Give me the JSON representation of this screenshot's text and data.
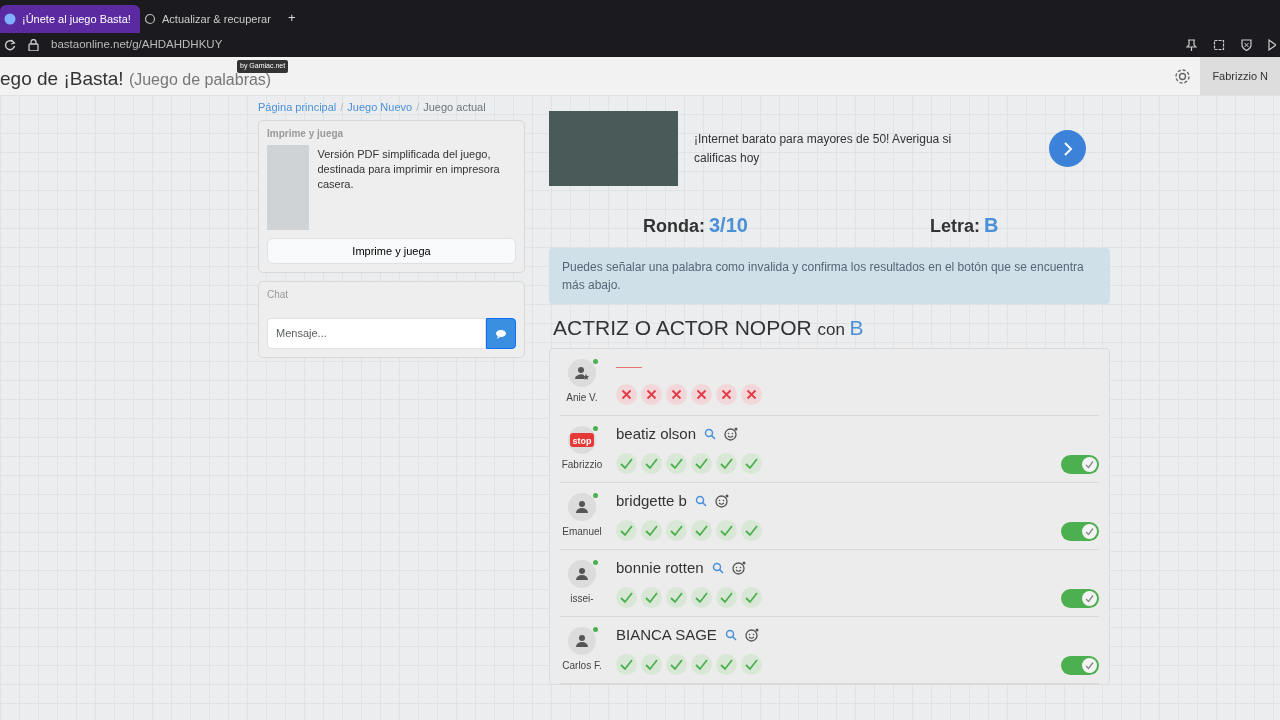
{
  "browser": {
    "tabs": [
      {
        "label": "¡Únete al juego Basta!",
        "selected": true
      },
      {
        "label": "Actualizar & recuperar",
        "selected": false
      }
    ],
    "new_tab": "+",
    "url": "bastaonline.net/g/AHDAHDHKUY"
  },
  "header": {
    "title": "ego de ¡Basta!",
    "subtitle": "(Juego de palabras)",
    "badge": "by Gamiac.net",
    "user": "Fabrizzio N"
  },
  "breadcrumb": [
    {
      "label": "Página principal",
      "kind": "link"
    },
    {
      "separator": "/",
      "label": "Juego Nuevo",
      "kind": "link"
    },
    {
      "separator": "/",
      "label": "Juego actual",
      "kind": "current"
    }
  ],
  "print_card": {
    "title": "Imprime y juega",
    "text": "Versión PDF simplificada del juego, destinada para imprimir en impresora casera.",
    "button": "Imprime y juega"
  },
  "chat": {
    "title": "Chat",
    "placeholder": "Mensaje..."
  },
  "ad": {
    "text": "¡Internet barato para mayores de 50! Averigua si calificas hoy"
  },
  "round": {
    "label": "Ronda:",
    "value": "3/10"
  },
  "letter": {
    "label": "Letra:",
    "value": "B"
  },
  "info": "Puedes señalar una palabra como invalida y confirma los resultados en el botón que se encuentra más abajo.",
  "category": {
    "name": "ACTRIZ O ACTOR NOPOR",
    "connector": "con",
    "letter": "B"
  },
  "answers": [
    {
      "player": "Anie V.",
      "kind": "star-user",
      "online": true,
      "votes": [
        {
          "valid": false
        },
        {
          "valid": false
        },
        {
          "valid": false
        },
        {
          "valid": false
        },
        {
          "valid": false
        },
        {
          "valid": false
        }
      ]
    },
    {
      "player": "Fabrizzio",
      "kind": "stop",
      "online": true,
      "answer": "beatiz olson",
      "votes": [
        {
          "valid": true
        },
        {
          "valid": true
        },
        {
          "valid": true
        },
        {
          "valid": true
        },
        {
          "valid": true
        },
        {
          "valid": true
        }
      ],
      "accepted": true
    },
    {
      "player": "Emanuel",
      "kind": "user",
      "online": true,
      "answer": "bridgette b",
      "votes": [
        {
          "valid": true
        },
        {
          "valid": true
        },
        {
          "valid": true
        },
        {
          "valid": true
        },
        {
          "valid": true
        },
        {
          "valid": true
        }
      ],
      "accepted": true
    },
    {
      "player": "issei-",
      "kind": "user",
      "online": true,
      "answer": "bonnie rotten",
      "votes": [
        {
          "valid": true
        },
        {
          "valid": true
        },
        {
          "valid": true
        },
        {
          "valid": true
        },
        {
          "valid": true
        },
        {
          "valid": true
        }
      ],
      "accepted": true
    },
    {
      "player": "Carlos F.",
      "kind": "user",
      "online": true,
      "answer": "BIANCA SAGE",
      "votes": [
        {
          "valid": true
        },
        {
          "valid": true
        },
        {
          "valid": true
        },
        {
          "valid": true
        },
        {
          "valid": true
        },
        {
          "valid": true
        }
      ],
      "accepted": true
    }
  ]
}
